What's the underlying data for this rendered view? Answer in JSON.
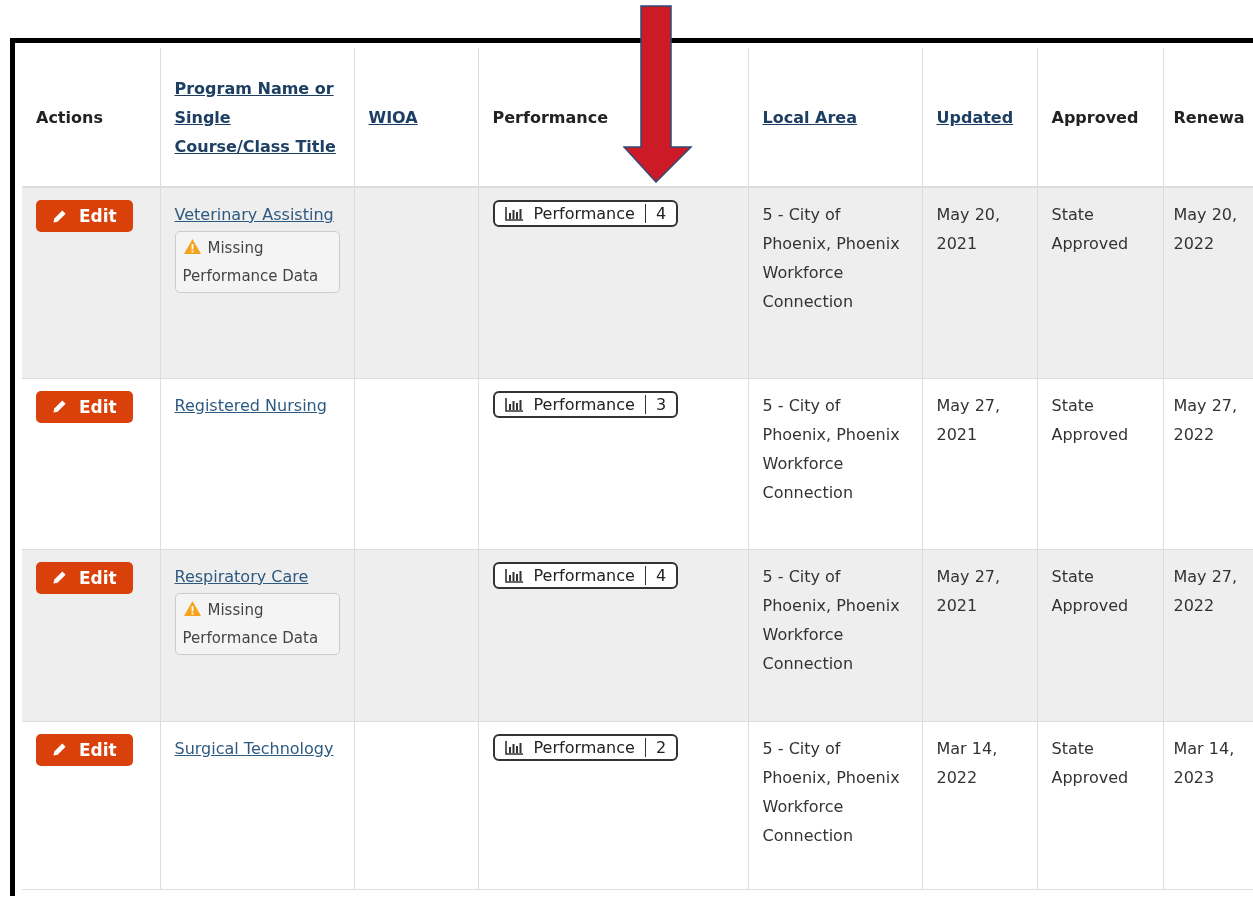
{
  "table": {
    "columns": [
      {
        "label": "Actions",
        "sortable": false
      },
      {
        "label": "Program Name or Single Course/Class Title",
        "sortable": true
      },
      {
        "label": "WIOA",
        "sortable": true
      },
      {
        "label": "Performance",
        "sortable": false
      },
      {
        "label": "Local Area",
        "sortable": true
      },
      {
        "label": "Updated",
        "sortable": true
      },
      {
        "label": "Approved",
        "sortable": false
      },
      {
        "label": "Renewa",
        "sortable": false
      }
    ],
    "rows": [
      {
        "action": "Edit",
        "program": "Veterinary Assisting",
        "warning": "Missing Performance Data",
        "performance": {
          "label": "Performance",
          "count": "4"
        },
        "local_area": "5 - City of Phoenix, Phoenix Workforce Connection",
        "updated": "May 20, 2021",
        "approved": "State Approved",
        "renewal": "May 20, 2022"
      },
      {
        "action": "Edit",
        "program": "Registered Nursing",
        "performance": {
          "label": "Performance",
          "count": "3"
        },
        "local_area": "5 - City of Phoenix, Phoenix Workforce Connection",
        "updated": "May 27, 2021",
        "approved": "State Approved",
        "renewal": "May 27, 2022"
      },
      {
        "action": "Edit",
        "program": "Respiratory Care",
        "warning": "Missing Performance Data",
        "performance": {
          "label": "Performance",
          "count": "4"
        },
        "local_area": "5 - City of Phoenix, Phoenix Workforce Connection",
        "updated": "May 27, 2021",
        "approved": "State Approved",
        "renewal": "May 27, 2022"
      },
      {
        "action": "Edit",
        "program": "Surgical Technology",
        "performance": {
          "label": "Performance",
          "count": "2"
        },
        "local_area": "5 - City of Phoenix, Phoenix Workforce Connection",
        "updated": "Mar 14, 2022",
        "approved": "State Approved",
        "renewal": "Mar 14, 2023"
      }
    ]
  },
  "annotation": {
    "kind": "arrow"
  }
}
